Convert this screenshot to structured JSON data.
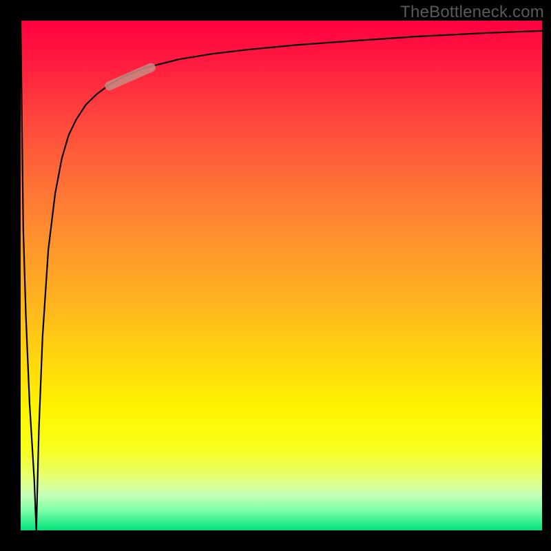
{
  "watermark": "TheBottleneck.com",
  "colors": {
    "background": "#000000",
    "curve": "#000000",
    "marker": "#c98982",
    "gradient_top": "#ff0040",
    "gradient_bottom": "#00e27a"
  },
  "chart_data": {
    "type": "line",
    "title": "",
    "xlabel": "",
    "ylabel": "",
    "xlim": [
      0,
      100
    ],
    "ylim": [
      0,
      100
    ],
    "series": [
      {
        "name": "bottleneck-curve",
        "x": [
          0,
          0.5,
          1.0,
          1.7,
          2.6,
          3.0,
          3.5,
          4.2,
          5.3,
          6.6,
          7.9,
          9.2,
          10.6,
          12.5,
          14.5,
          17.1,
          19.7,
          23.7,
          30.3,
          36.8,
          43.4,
          52.6,
          63.2,
          76.3,
          89.5,
          100
        ],
        "y": [
          100,
          59,
          42,
          25,
          10,
          0,
          20,
          38,
          55,
          66,
          73,
          77.5,
          80.5,
          83.5,
          85.5,
          87.5,
          89,
          90.7,
          92.4,
          93.5,
          94.3,
          95.2,
          96,
          96.9,
          97.6,
          98
        ]
      }
    ],
    "marker": {
      "name": "highlight-segment",
      "x_from": 17.0,
      "y_from": 87.2,
      "x_to": 25.0,
      "y_to": 90.8
    }
  }
}
